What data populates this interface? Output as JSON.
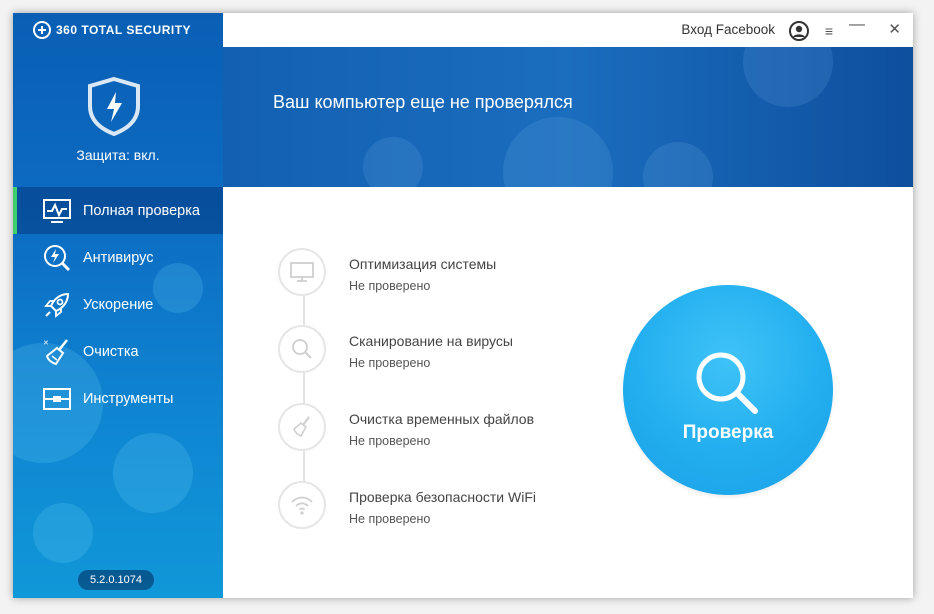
{
  "app": {
    "brand": "360 TOTAL SECURITY",
    "protection_status": "Защита: вкл.",
    "version": "5.2.0.1074"
  },
  "sidebar": {
    "items": [
      {
        "label": "Полная проверка",
        "icon": "monitor-pulse-icon",
        "active": true
      },
      {
        "label": "Антивирус",
        "icon": "antivirus-icon",
        "active": false
      },
      {
        "label": "Ускорение",
        "icon": "rocket-icon",
        "active": false
      },
      {
        "label": "Очистка",
        "icon": "broom-icon",
        "active": false
      },
      {
        "label": "Инструменты",
        "icon": "toolbox-icon",
        "active": false
      }
    ]
  },
  "topbar": {
    "login_label": "Вход Facebook",
    "menu_glyph": "≡",
    "minimize_glyph": "—",
    "close_glyph": "✕"
  },
  "banner": {
    "title": "Ваш компьютер еще не проверялся"
  },
  "checks": [
    {
      "title": "Оптимизация системы",
      "status": "Не проверено",
      "icon": "monitor-icon"
    },
    {
      "title": "Сканирование на вирусы",
      "status": "Не проверено",
      "icon": "search-icon"
    },
    {
      "title": "Очистка временных файлов",
      "status": "Не проверено",
      "icon": "broom-icon"
    },
    {
      "title": "Проверка безопасности WiFi",
      "status": "Не проверено",
      "icon": "wifi-icon"
    }
  ],
  "scan_button": {
    "label": "Проверка",
    "icon": "magnifier-icon"
  },
  "colors": {
    "accent_green": "#3ccf6b",
    "scan_blue": "#22aeef",
    "sidebar_blue": "#0c6cc2"
  }
}
